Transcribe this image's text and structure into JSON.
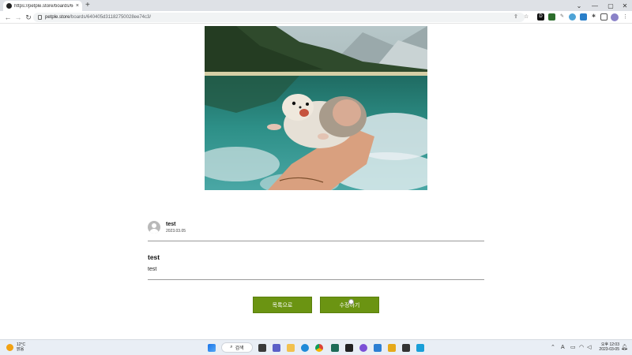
{
  "browser": {
    "tab_title": "https://petple.store/boards/640...",
    "tab_close": "×",
    "new_tab": "+",
    "url_host": "petple.store",
    "url_path": "/boards/640405d31182750028ee74c3/",
    "ext_label": "D"
  },
  "post": {
    "author": "test",
    "date": "2023.03.05",
    "title": "test",
    "body": "test"
  },
  "buttons": {
    "list_label": "목록으로",
    "edit_label": "수정하기"
  },
  "taskbar": {
    "temperature": "12°C",
    "weather_desc": "맑음",
    "search_label": "검색",
    "time_label": "오후 12:03",
    "date_label": "2023-03-05",
    "tray_letter": "A"
  },
  "colors": {
    "button_green": "#6b9412",
    "divider": "#9a9a9a"
  },
  "icons": [
    "back-icon",
    "forward-icon",
    "reload-icon",
    "lock-icon",
    "share-icon",
    "bookmark-star-icon",
    "extensions-icon",
    "windows-start-icon",
    "search-icon"
  ]
}
